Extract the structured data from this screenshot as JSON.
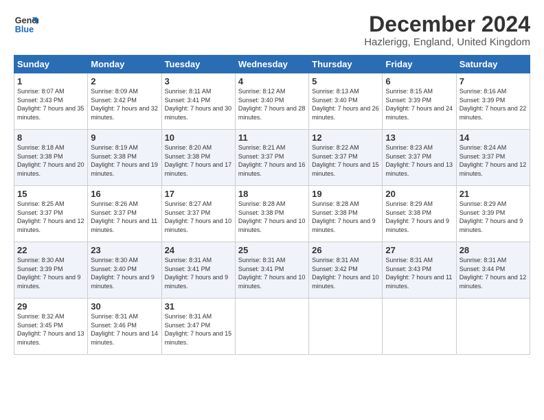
{
  "logo": {
    "line1": "General",
    "line2": "Blue"
  },
  "title": "December 2024",
  "location": "Hazlerigg, England, United Kingdom",
  "days_of_week": [
    "Sunday",
    "Monday",
    "Tuesday",
    "Wednesday",
    "Thursday",
    "Friday",
    "Saturday"
  ],
  "weeks": [
    [
      {
        "day": "1",
        "sunrise": "Sunrise: 8:07 AM",
        "sunset": "Sunset: 3:43 PM",
        "daylight": "Daylight: 7 hours and 35 minutes."
      },
      {
        "day": "2",
        "sunrise": "Sunrise: 8:09 AM",
        "sunset": "Sunset: 3:42 PM",
        "daylight": "Daylight: 7 hours and 32 minutes."
      },
      {
        "day": "3",
        "sunrise": "Sunrise: 8:11 AM",
        "sunset": "Sunset: 3:41 PM",
        "daylight": "Daylight: 7 hours and 30 minutes."
      },
      {
        "day": "4",
        "sunrise": "Sunrise: 8:12 AM",
        "sunset": "Sunset: 3:40 PM",
        "daylight": "Daylight: 7 hours and 28 minutes."
      },
      {
        "day": "5",
        "sunrise": "Sunrise: 8:13 AM",
        "sunset": "Sunset: 3:40 PM",
        "daylight": "Daylight: 7 hours and 26 minutes."
      },
      {
        "day": "6",
        "sunrise": "Sunrise: 8:15 AM",
        "sunset": "Sunset: 3:39 PM",
        "daylight": "Daylight: 7 hours and 24 minutes."
      },
      {
        "day": "7",
        "sunrise": "Sunrise: 8:16 AM",
        "sunset": "Sunset: 3:39 PM",
        "daylight": "Daylight: 7 hours and 22 minutes."
      }
    ],
    [
      {
        "day": "8",
        "sunrise": "Sunrise: 8:18 AM",
        "sunset": "Sunset: 3:38 PM",
        "daylight": "Daylight: 7 hours and 20 minutes."
      },
      {
        "day": "9",
        "sunrise": "Sunrise: 8:19 AM",
        "sunset": "Sunset: 3:38 PM",
        "daylight": "Daylight: 7 hours and 19 minutes."
      },
      {
        "day": "10",
        "sunrise": "Sunrise: 8:20 AM",
        "sunset": "Sunset: 3:38 PM",
        "daylight": "Daylight: 7 hours and 17 minutes."
      },
      {
        "day": "11",
        "sunrise": "Sunrise: 8:21 AM",
        "sunset": "Sunset: 3:37 PM",
        "daylight": "Daylight: 7 hours and 16 minutes."
      },
      {
        "day": "12",
        "sunrise": "Sunrise: 8:22 AM",
        "sunset": "Sunset: 3:37 PM",
        "daylight": "Daylight: 7 hours and 15 minutes."
      },
      {
        "day": "13",
        "sunrise": "Sunrise: 8:23 AM",
        "sunset": "Sunset: 3:37 PM",
        "daylight": "Daylight: 7 hours and 13 minutes."
      },
      {
        "day": "14",
        "sunrise": "Sunrise: 8:24 AM",
        "sunset": "Sunset: 3:37 PM",
        "daylight": "Daylight: 7 hours and 12 minutes."
      }
    ],
    [
      {
        "day": "15",
        "sunrise": "Sunrise: 8:25 AM",
        "sunset": "Sunset: 3:37 PM",
        "daylight": "Daylight: 7 hours and 12 minutes."
      },
      {
        "day": "16",
        "sunrise": "Sunrise: 8:26 AM",
        "sunset": "Sunset: 3:37 PM",
        "daylight": "Daylight: 7 hours and 11 minutes."
      },
      {
        "day": "17",
        "sunrise": "Sunrise: 8:27 AM",
        "sunset": "Sunset: 3:37 PM",
        "daylight": "Daylight: 7 hours and 10 minutes."
      },
      {
        "day": "18",
        "sunrise": "Sunrise: 8:28 AM",
        "sunset": "Sunset: 3:38 PM",
        "daylight": "Daylight: 7 hours and 10 minutes."
      },
      {
        "day": "19",
        "sunrise": "Sunrise: 8:28 AM",
        "sunset": "Sunset: 3:38 PM",
        "daylight": "Daylight: 7 hours and 9 minutes."
      },
      {
        "day": "20",
        "sunrise": "Sunrise: 8:29 AM",
        "sunset": "Sunset: 3:38 PM",
        "daylight": "Daylight: 7 hours and 9 minutes."
      },
      {
        "day": "21",
        "sunrise": "Sunrise: 8:29 AM",
        "sunset": "Sunset: 3:39 PM",
        "daylight": "Daylight: 7 hours and 9 minutes."
      }
    ],
    [
      {
        "day": "22",
        "sunrise": "Sunrise: 8:30 AM",
        "sunset": "Sunset: 3:39 PM",
        "daylight": "Daylight: 7 hours and 9 minutes."
      },
      {
        "day": "23",
        "sunrise": "Sunrise: 8:30 AM",
        "sunset": "Sunset: 3:40 PM",
        "daylight": "Daylight: 7 hours and 9 minutes."
      },
      {
        "day": "24",
        "sunrise": "Sunrise: 8:31 AM",
        "sunset": "Sunset: 3:41 PM",
        "daylight": "Daylight: 7 hours and 9 minutes."
      },
      {
        "day": "25",
        "sunrise": "Sunrise: 8:31 AM",
        "sunset": "Sunset: 3:41 PM",
        "daylight": "Daylight: 7 hours and 10 minutes."
      },
      {
        "day": "26",
        "sunrise": "Sunrise: 8:31 AM",
        "sunset": "Sunset: 3:42 PM",
        "daylight": "Daylight: 7 hours and 10 minutes."
      },
      {
        "day": "27",
        "sunrise": "Sunrise: 8:31 AM",
        "sunset": "Sunset: 3:43 PM",
        "daylight": "Daylight: 7 hours and 11 minutes."
      },
      {
        "day": "28",
        "sunrise": "Sunrise: 8:31 AM",
        "sunset": "Sunset: 3:44 PM",
        "daylight": "Daylight: 7 hours and 12 minutes."
      }
    ],
    [
      {
        "day": "29",
        "sunrise": "Sunrise: 8:32 AM",
        "sunset": "Sunset: 3:45 PM",
        "daylight": "Daylight: 7 hours and 13 minutes."
      },
      {
        "day": "30",
        "sunrise": "Sunrise: 8:31 AM",
        "sunset": "Sunset: 3:46 PM",
        "daylight": "Daylight: 7 hours and 14 minutes."
      },
      {
        "day": "31",
        "sunrise": "Sunrise: 8:31 AM",
        "sunset": "Sunset: 3:47 PM",
        "daylight": "Daylight: 7 hours and 15 minutes."
      },
      null,
      null,
      null,
      null
    ]
  ]
}
